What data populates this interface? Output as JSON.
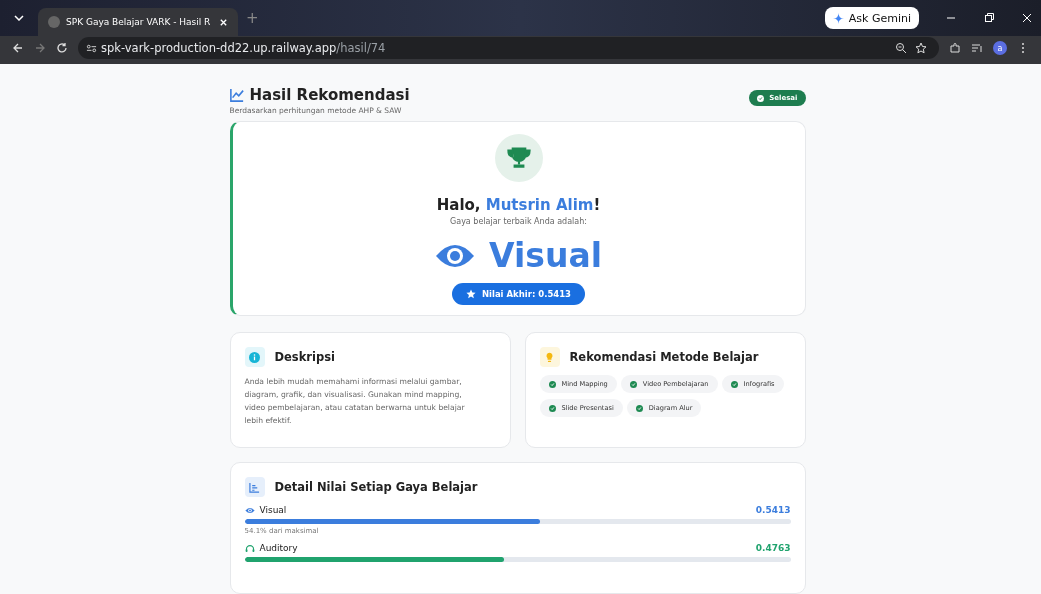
{
  "browser": {
    "tab_title": "SPK Gaya Belajar VARK - Hasil R",
    "new_tab": "+",
    "gemini": "Ask Gemini",
    "url_host": "spk-vark-production-dd22.up.railway.app",
    "url_path": "/hasil/74",
    "avatar": "a"
  },
  "header": {
    "title": "Hasil Rekomendasi",
    "subtitle": "Berdasarkan perhitungan metode AHP & SAW",
    "status": "Selesai"
  },
  "result": {
    "greeting": "Halo, ",
    "name": "Mutsrin Alim",
    "exclaim": "!",
    "lead": "Gaya belajar terbaik Anda adalah:",
    "style": "Visual",
    "score": "Nilai Akhir: 0.5413"
  },
  "description": {
    "title": "Deskripsi",
    "text": "Anda lebih mudah memahami informasi melalui gambar, diagram, grafik, dan visualisasi. Gunakan mind mapping, video pembelajaran, atau catatan berwarna untuk belajar lebih efektif."
  },
  "methods": {
    "title": "Rekomendasi Metode Belajar",
    "items": [
      "Mind Mapping",
      "Video Pembelajaran",
      "Infografis",
      "Slide Presentasi",
      "Diagram Alur"
    ]
  },
  "details": {
    "title": "Detail Nilai Setiap Gaya Belajar",
    "items": [
      {
        "kind": "eye",
        "name": "Visual",
        "value": "0.5413",
        "level": 0.541,
        "color": "#3b7ddd",
        "note": "54.1% dari maksimal"
      },
      {
        "kind": "headphones",
        "name": "Auditory",
        "value": "0.4763",
        "level": 0.476,
        "color": "#20a36e"
      }
    ]
  }
}
